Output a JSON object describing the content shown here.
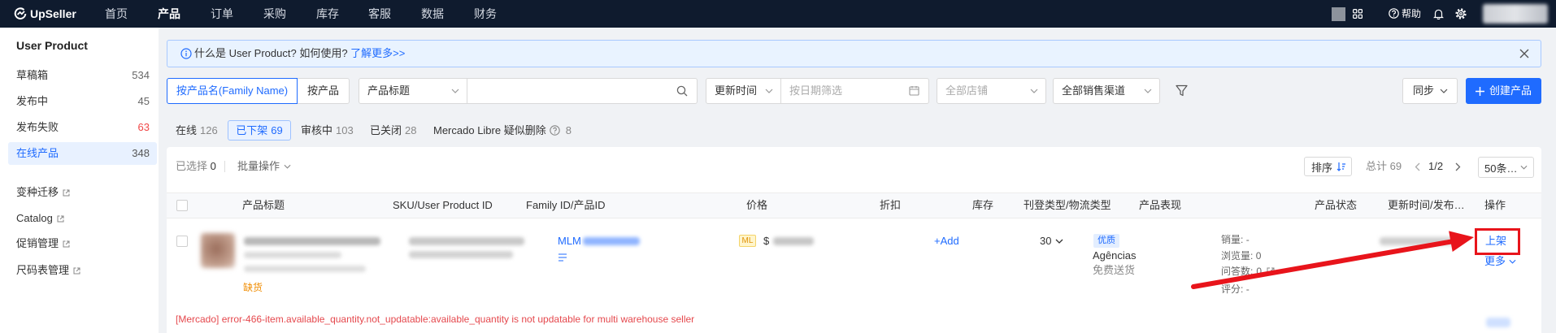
{
  "app": {
    "name": "UpSeller"
  },
  "topnav": {
    "items": [
      {
        "label": "首页"
      },
      {
        "label": "产品",
        "active": true
      },
      {
        "label": "订单"
      },
      {
        "label": "采购"
      },
      {
        "label": "库存"
      },
      {
        "label": "客服"
      },
      {
        "label": "数据"
      },
      {
        "label": "财务"
      }
    ],
    "help_label": "帮助"
  },
  "sidebar": {
    "title": "User Product",
    "items": [
      {
        "label": "草稿箱",
        "count": "534"
      },
      {
        "label": "发布中",
        "count": "45"
      },
      {
        "label": "发布失败",
        "count": "63"
      },
      {
        "label": "在线产品",
        "count": "348",
        "active": true
      }
    ],
    "links": [
      {
        "label": "变种迁移"
      },
      {
        "label": "Catalog"
      },
      {
        "label": "促销管理"
      },
      {
        "label": "尺码表管理"
      }
    ]
  },
  "banner": {
    "text": "什么是 User Product? 如何使用?",
    "link": "了解更多>>"
  },
  "filters": {
    "mode_options": [
      "按产品名(Family Name)",
      "按产品"
    ],
    "field_select": "产品标题",
    "time_select": "更新时间",
    "date_placeholder": "按日期筛选",
    "store_select": "全部店铺",
    "channel_select": "全部销售渠道",
    "sync_label": "同步",
    "create_label": "创建产品"
  },
  "status_tabs": [
    {
      "label": "在线",
      "count": "126"
    },
    {
      "label": "已下架",
      "count": "69",
      "active": true
    },
    {
      "label": "审核中",
      "count": "103"
    },
    {
      "label": "已关闭",
      "count": "28"
    },
    {
      "label": "Mercado Libre 疑似删除",
      "count": "8"
    }
  ],
  "toolbar": {
    "selected_label": "已选择",
    "selected_count": "0",
    "batch_label": "批量操作",
    "sort_label": "排序",
    "total_label": "总计",
    "total_count": "69",
    "page": "1/2",
    "page_size": "50条…"
  },
  "table": {
    "columns": [
      "产品标题",
      "SKU/User Product ID",
      "Family ID/产品ID",
      "价格",
      "折扣",
      "库存",
      "刊登类型/物流类型",
      "产品表现",
      "产品状态",
      "更新时间/发布…",
      "操作"
    ],
    "rows": [
      {
        "stock_status": "缺货",
        "family_id_prefix": "MLM",
        "channel_badge": "ML",
        "currency": "$",
        "discount_action": "+Add",
        "stock": "30",
        "listing_type": "优质",
        "logistics_type": "Agências",
        "shipping": "免费送货",
        "performance": [
          {
            "label": "销量:",
            "value": "-"
          },
          {
            "label": "浏览量:",
            "value": "0"
          },
          {
            "label": "问答数:",
            "value": "0"
          },
          {
            "label": "评分:",
            "value": "-"
          }
        ],
        "action_primary": "上架",
        "action_more": "更多",
        "error": "[Mercado] error-466-item.available_quantity.not_updatable:available_quantity is not updatable for multi warehouse seller"
      }
    ]
  },
  "colors": {
    "nav_bg": "#0f1b2e",
    "page_bg": "#f0f2f5",
    "primary": "#1f6bff",
    "error": "#e5484d",
    "warning": "#f08c00",
    "annotation": "#e8141b"
  },
  "icons": [
    "logo-icon",
    "apps-grid-icon",
    "help-icon",
    "bell-icon",
    "gear-icon",
    "info-icon",
    "close-icon",
    "search-icon",
    "calendar-icon",
    "filter-icon",
    "plus-icon",
    "sort-icon",
    "external-link-icon",
    "question-circle-icon"
  ]
}
